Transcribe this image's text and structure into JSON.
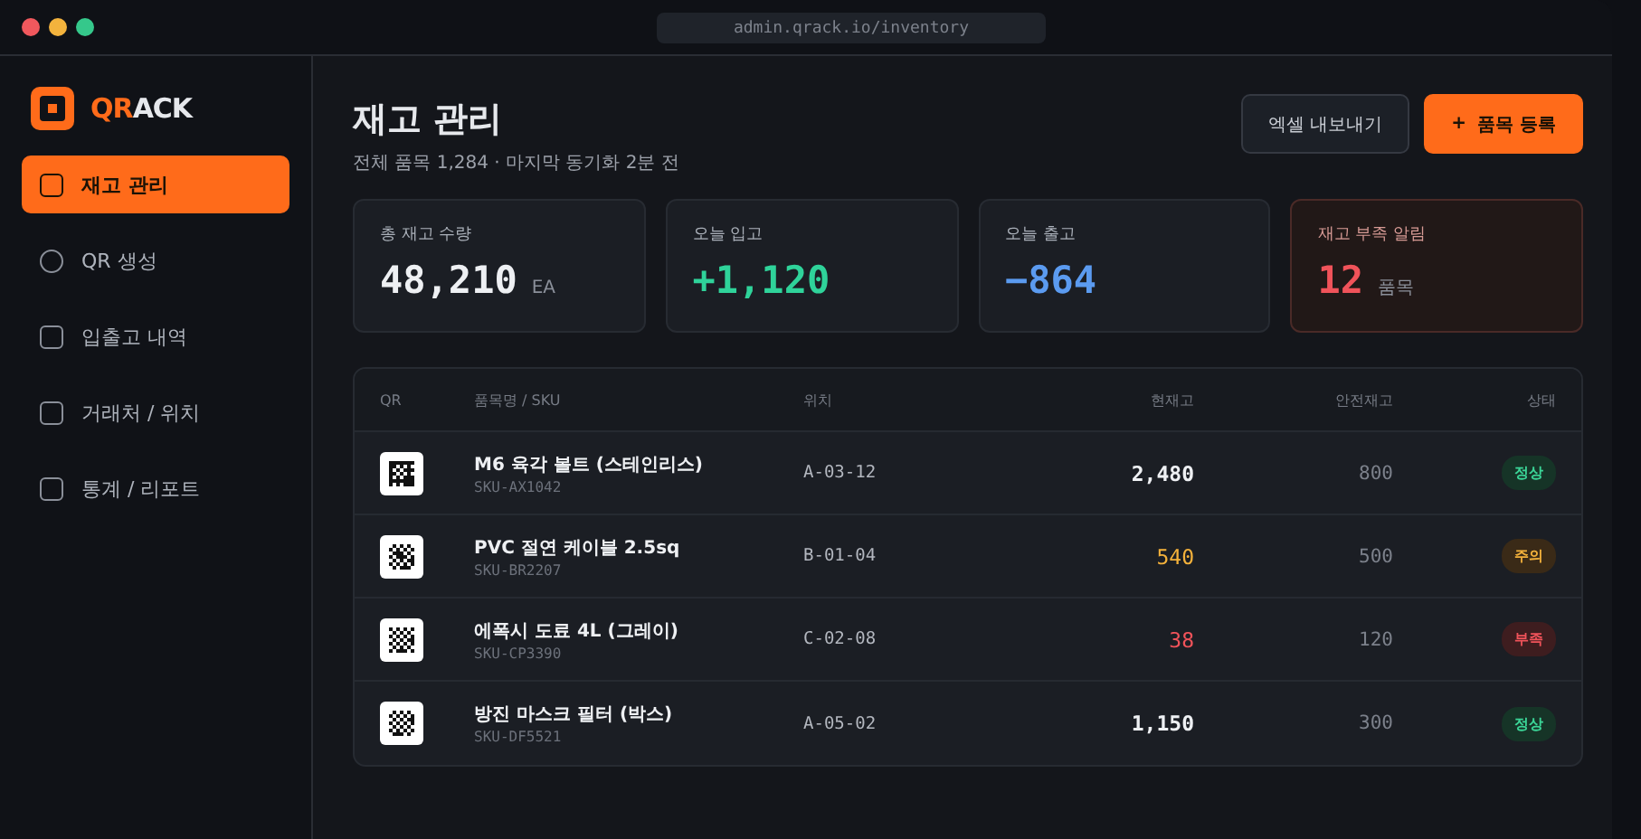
{
  "browser": {
    "url": "admin.qrack.io/inventory"
  },
  "brand": {
    "accent": "QR",
    "rest": "ACK"
  },
  "sidebar": {
    "items": [
      {
        "label": "재고 관리",
        "kind": "square",
        "selected": true
      },
      {
        "label": "QR 생성",
        "kind": "circle",
        "selected": false
      },
      {
        "label": "입출고 내역",
        "kind": "square",
        "selected": false
      },
      {
        "label": "거래처 / 위치",
        "kind": "square",
        "selected": false
      },
      {
        "label": "통계 / 리포트",
        "kind": "square",
        "selected": false
      }
    ]
  },
  "header": {
    "title": "재고 관리",
    "subtitle": "전체 품목 1,284 · 마지막 동기화 2분 전",
    "buttons": [
      {
        "label": "엑셀 내보내기",
        "kind": "secondary"
      },
      {
        "label": "품목 등록",
        "kind": "primary",
        "icon": "+"
      }
    ]
  },
  "stats": [
    {
      "label": "총 재고 수량",
      "value": "48,210",
      "unit": "EA",
      "kind": "total"
    },
    {
      "label": "오늘 입고",
      "value": "+1,120",
      "kind": "in"
    },
    {
      "label": "오늘 출고",
      "value": "−864",
      "kind": "out"
    },
    {
      "label": "재고 부족 알림",
      "value": "12",
      "unit": "품목",
      "kind": "alert"
    }
  ],
  "table": {
    "columns": [
      "QR",
      "품목명 / SKU",
      "위치",
      "현재고",
      "안전재고",
      "상태"
    ],
    "rows": [
      {
        "name": "M6 육각 볼트 (스테인리스)",
        "sku": "SKU-AX1042",
        "location": "A-03-12",
        "stock": "2,480",
        "safety": "800",
        "status": "정상",
        "kind": "ok"
      },
      {
        "name": "PVC 절연 케이블 2.5sq",
        "sku": "SKU-BR2207",
        "location": "B-01-04",
        "stock": "540",
        "safety": "500",
        "status": "주의",
        "kind": "warn"
      },
      {
        "name": "에폭시 도료 4L (그레이)",
        "sku": "SKU-CP3390",
        "location": "C-02-08",
        "stock": "38",
        "safety": "120",
        "status": "부족",
        "kind": "low"
      },
      {
        "name": "방진 마스크 필터 (박스)",
        "sku": "SKU-DF5521",
        "location": "A-05-02",
        "stock": "1,150",
        "safety": "300",
        "status": "정상",
        "kind": "ok"
      }
    ]
  }
}
